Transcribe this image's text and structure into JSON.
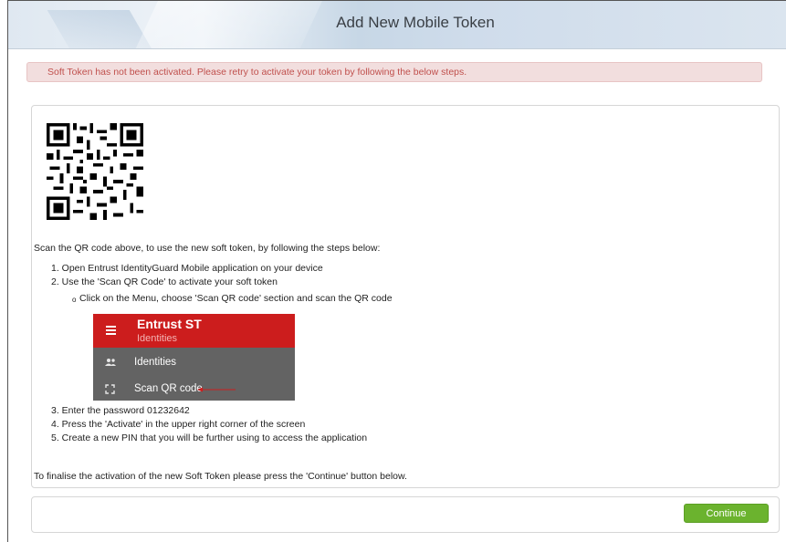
{
  "header": {
    "title": "Add New Mobile Token"
  },
  "alert": {
    "message": "Soft Token has not been activated. Please retry to activate your token by following the below steps."
  },
  "instructions": {
    "intro": "Scan the QR code above, to use the new soft token, by following the steps below:",
    "step1": "1. Open Entrust IdentityGuard Mobile application on your device",
    "step2": "2. Use the 'Scan QR Code' to activate your soft token",
    "sub_bullet": "o",
    "sub_step": "Click on the Menu, choose 'Scan QR code' section and scan the QR code",
    "step3": "3. Enter the password 01232642",
    "step4": "4. Press the 'Activate' in the upper right corner of the screen",
    "step5": "5. Create a new PIN that you will be further using to access the application",
    "finalise": "To finalise the activation of the new Soft Token please press the 'Continue' button below."
  },
  "app_screenshot": {
    "title": "Entrust ST",
    "subtitle": "Identities",
    "item1": "Identities",
    "item2": "Scan QR code",
    "colors": {
      "bar": "#cc1d1d",
      "body": "#636363",
      "arrow": "#cc1d1d"
    }
  },
  "footer": {
    "continue_label": "Continue"
  },
  "colors": {
    "alert_bg": "#f2dede",
    "alert_text": "#c0504d",
    "button": "#6bb32e"
  }
}
